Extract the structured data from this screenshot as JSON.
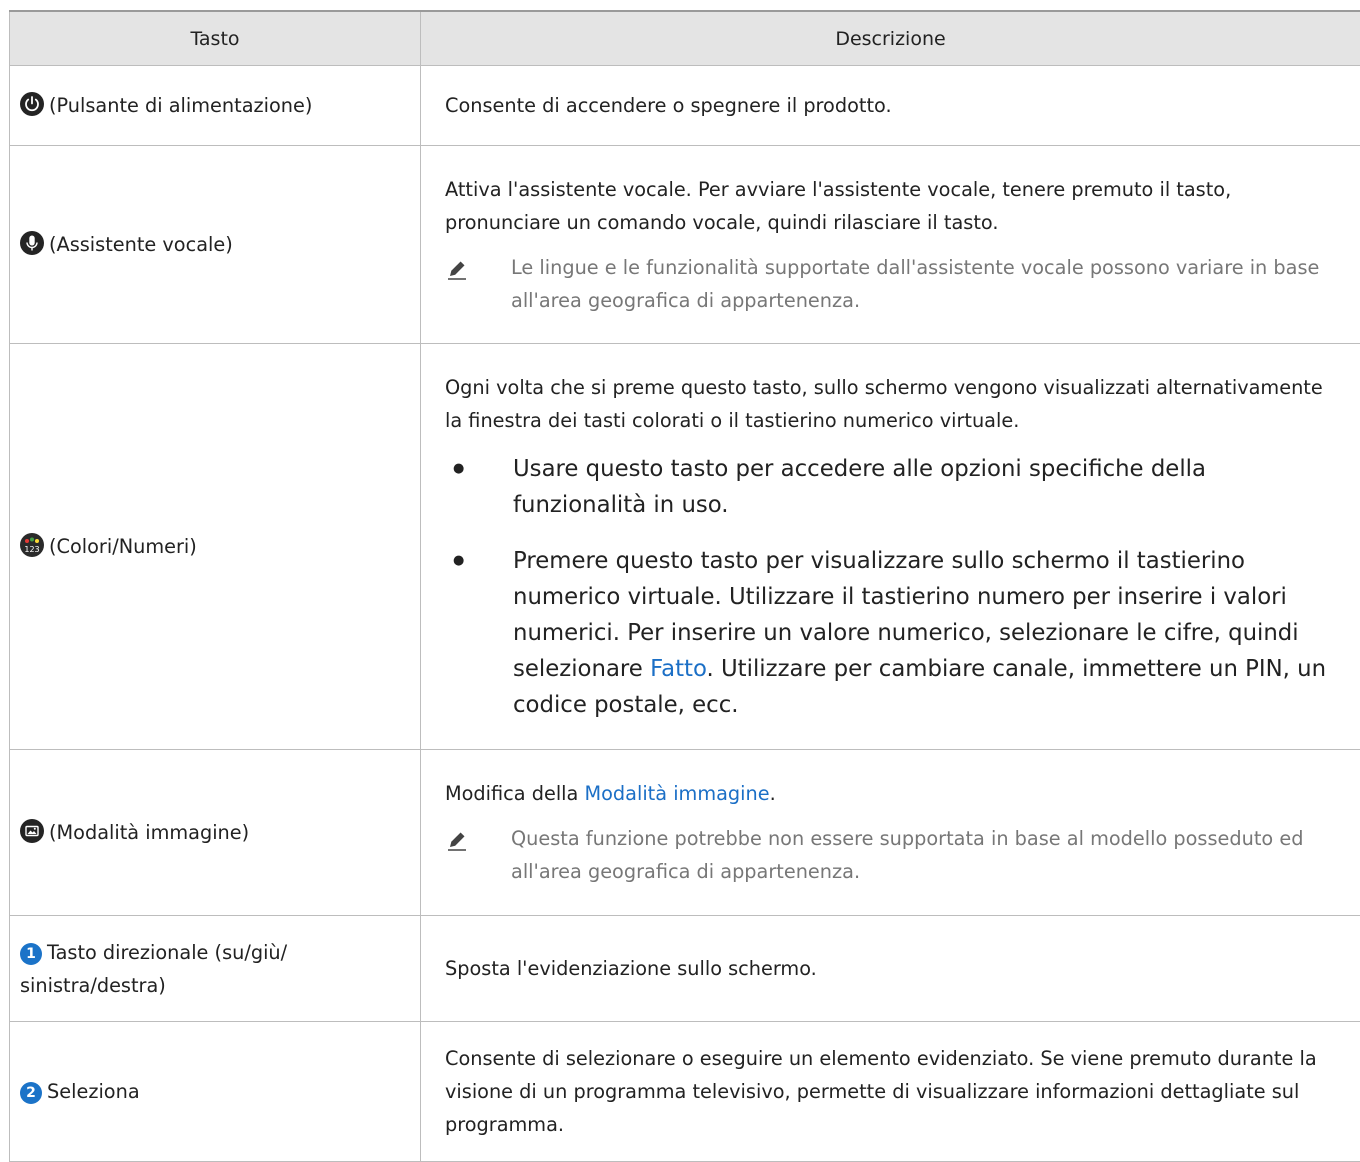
{
  "table": {
    "headers": {
      "key": "Tasto",
      "desc": "Descrizione"
    },
    "rows": [
      {
        "key_icon": "power-icon",
        "key": "(Pulsante di alimentazione)",
        "desc": "Consente di accendere o spegnere il prodotto."
      },
      {
        "key_icon": "microphone-icon",
        "key": "(Assistente vocale)",
        "desc": "Attiva l'assistente vocale. Per avviare l'assistente vocale, tenere premuto il tasto, pronunciare un comando vocale, quindi rilasciare il tasto.",
        "note": "Le lingue e le funzionalità supportate dall'assistente vocale possono variare in base all'area geografica di appartenenza."
      },
      {
        "key_icon": "color-number-icon",
        "key": "(Colori/Numeri)",
        "desc": "Ogni volta che si preme questo tasto, sullo schermo vengono visualizzati alternativamente la finestra dei tasti colorati o il tastierino numerico virtuale.",
        "bullet1": "Usare questo tasto per accedere alle opzioni specifiche della funzionalità in uso.",
        "bullet2_a": "Premere questo tasto per visualizzare sullo schermo il tastierino numerico virtuale. Utilizzare il tastierino numero per inserire i valori numerici. Per inserire un valore numerico, selezionare le cifre, quindi selezionare ",
        "bullet2_link": "Fatto",
        "bullet2_b": ". Utilizzare per cambiare canale, immettere un PIN, un codice postale, ecc."
      },
      {
        "key_icon": "picture-mode-icon",
        "key": "(Modalità immagine)",
        "desc_a": "Modifica della ",
        "desc_link": "Modalità immagine",
        "desc_b": ".",
        "note": "Questa funzione potrebbe non essere supportata in base al modello posseduto ed all'area geografica di appartenenza."
      },
      {
        "key_number": "1",
        "key": "Tasto direzionale (su/giù/ sinistra/destra)",
        "desc": "Sposta l'evidenziazione sullo schermo."
      },
      {
        "key_number": "2",
        "key": "Seleziona",
        "desc": "Consente di selezionare o eseguire un elemento evidenziato. Se viene premuto durante la visione di un programma televisivo, permette di visualizzare informazioni dettagliate sul programma."
      }
    ]
  },
  "colors": {
    "header_bg": "#e4e4e4",
    "border": "#bdbdbd",
    "link": "#1b6fc6",
    "note_text": "#777777",
    "number_badge": "#1b73c8"
  }
}
